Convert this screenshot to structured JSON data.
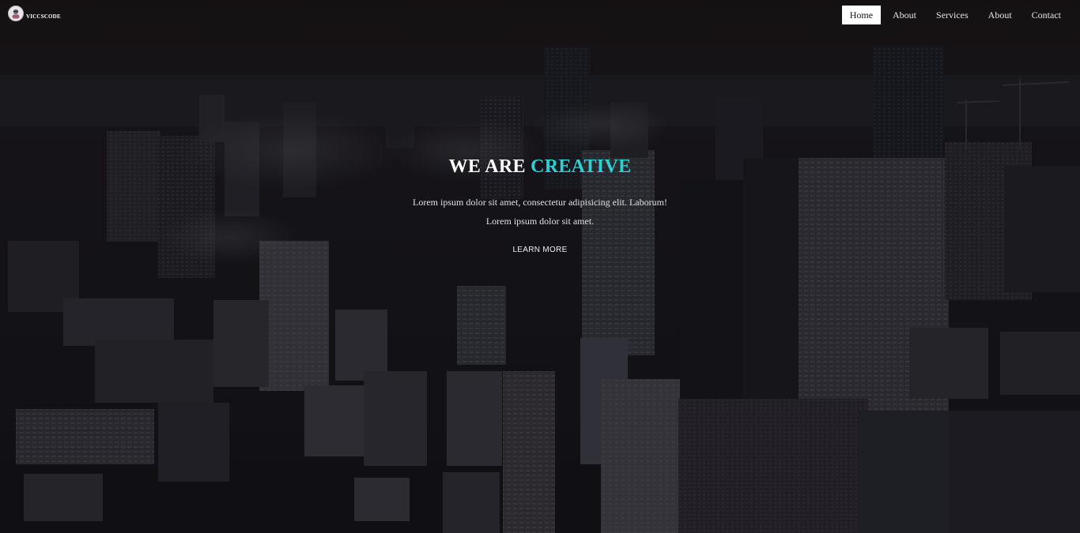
{
  "brand": {
    "name": "VICCSCODE"
  },
  "nav": {
    "items": [
      {
        "label": "Home",
        "active": true
      },
      {
        "label": "About",
        "active": false
      },
      {
        "label": "Services",
        "active": false
      },
      {
        "label": "About",
        "active": false
      },
      {
        "label": "Contact",
        "active": false
      }
    ]
  },
  "hero": {
    "headline_prefix": "WE ARE",
    "headline_accent": "CREATIVE",
    "paragraph_1": "Lorem ipsum dolor sit amet, consectetur adipisicing elit. Laborum!",
    "paragraph_2": "Lorem ipsum dolor sit amet.",
    "cta_label": "LEARN MORE",
    "background": "aerial city skyline at dusk, dark overlay"
  },
  "colors": {
    "accent": "#2bd3d8",
    "text": "#ffffff",
    "nav_active_bg": "#ffffff",
    "background": "#16161c"
  },
  "icons": {
    "logo": "avatar-logo-icon"
  }
}
